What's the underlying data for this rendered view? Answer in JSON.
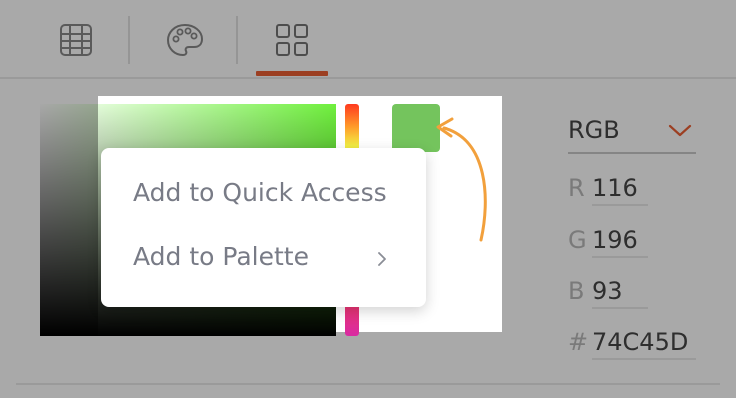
{
  "toolbar": {
    "tabs": [
      {
        "icon": "table-icon"
      },
      {
        "icon": "palette-icon"
      },
      {
        "icon": "grid-icon",
        "selected": true
      }
    ],
    "accent": "#9c3f22"
  },
  "picker": {
    "selected_color": "#74c45d"
  },
  "context_menu": {
    "items": [
      {
        "label": "Add to Quick Access"
      },
      {
        "label": "Add to Palette",
        "has_submenu": true
      }
    ]
  },
  "color_values": {
    "mode": "RGB",
    "r_label": "R",
    "r": "116",
    "g_label": "G",
    "g": "196",
    "b_label": "B",
    "b": "93",
    "hex_label": "#",
    "hex": "74C45D"
  }
}
